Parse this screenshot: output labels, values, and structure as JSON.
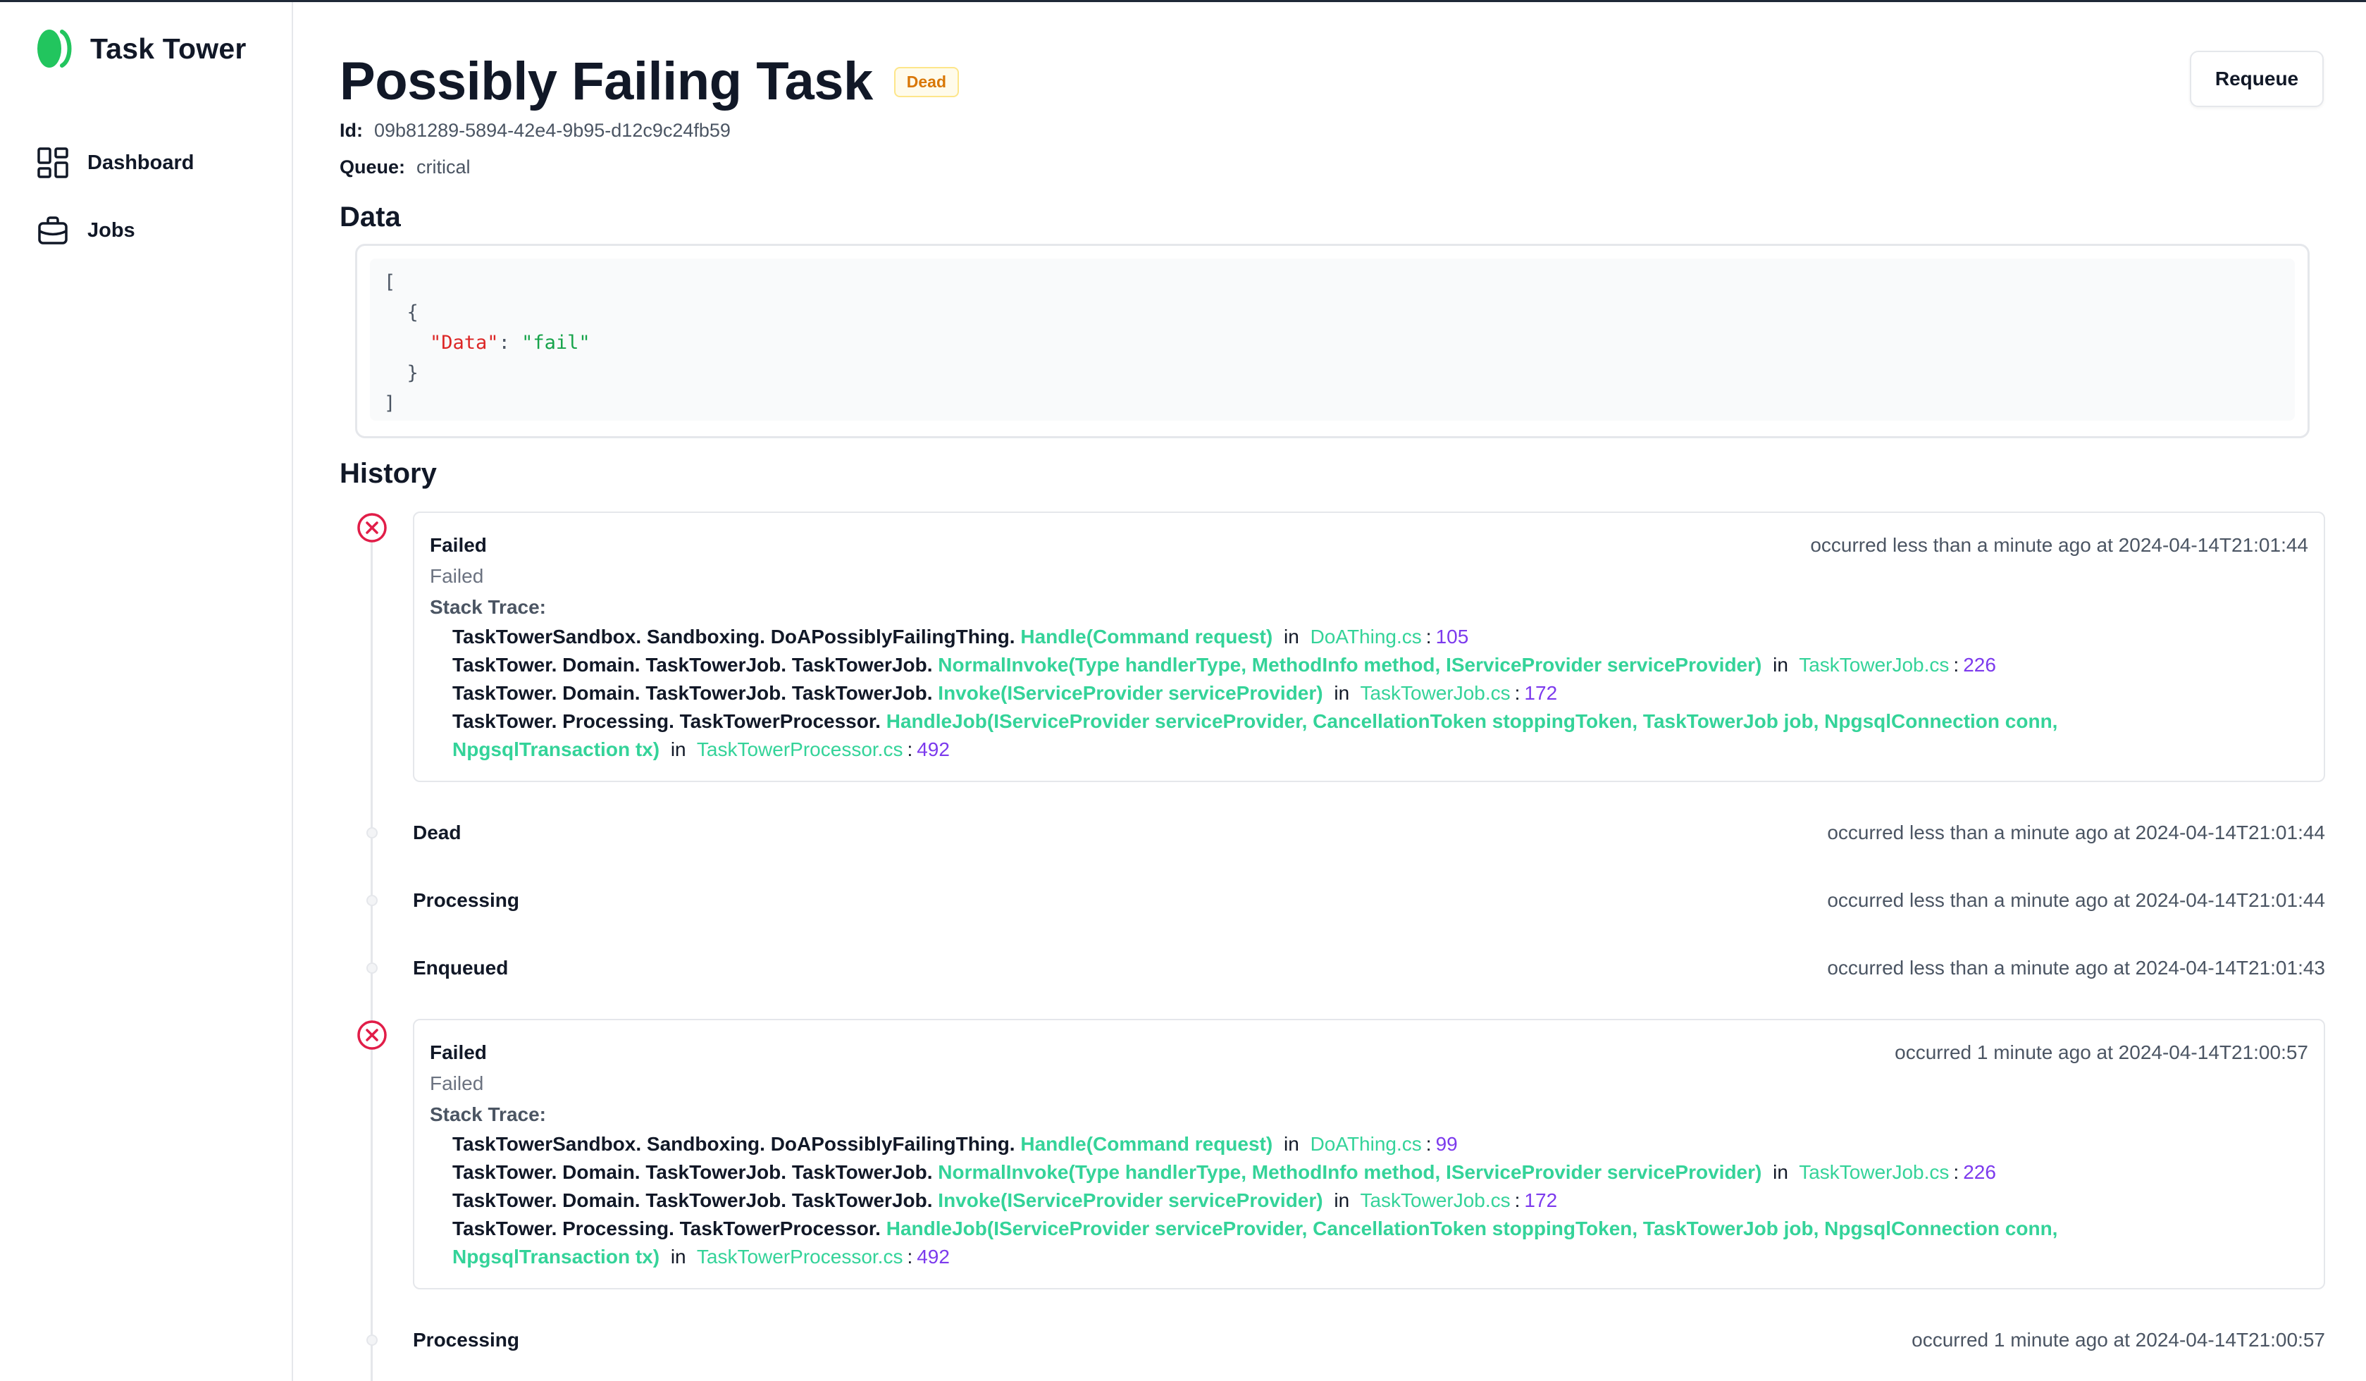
{
  "app": {
    "name": "Task Tower",
    "brand_color": "#22c55e"
  },
  "sidebar": {
    "items": [
      {
        "label": "Dashboard",
        "icon": "dashboard-grid-icon"
      },
      {
        "label": "Jobs",
        "icon": "briefcase-icon"
      }
    ]
  },
  "task": {
    "title": "Possibly Failing Task",
    "status_badge": "Dead",
    "id_label": "Id:",
    "id": "09b81289-5894-42e4-9b95-d12c9c24fb59",
    "queue_label": "Queue:",
    "queue": "critical",
    "requeue_label": "Requeue"
  },
  "data_section": {
    "heading": "Data",
    "json_key": "\"Data\"",
    "json_value": "\"fail\""
  },
  "history": {
    "heading": "History",
    "events": [
      {
        "type": "failed",
        "title": "Failed",
        "subtitle": "Failed",
        "stack_label": "Stack Trace:",
        "occurred": "occurred less than a minute ago at 2024-04-14T21:01:44",
        "trace": [
          {
            "ns": "TaskTowerSandbox. Sandboxing. DoAPossiblyFailingThing.",
            "fn": "Handle(Command request)",
            "in": "in",
            "file": "DoAThing.cs",
            "line": "105"
          },
          {
            "ns": "TaskTower. Domain. TaskTowerJob. TaskTowerJob.",
            "fn": "NormalInvoke(Type handlerType, MethodInfo method, IServiceProvider serviceProvider)",
            "in": "in",
            "file": "TaskTowerJob.cs",
            "line": "226"
          },
          {
            "ns": "TaskTower. Domain. TaskTowerJob. TaskTowerJob.",
            "fn": "Invoke(IServiceProvider serviceProvider)",
            "in": "in",
            "file": "TaskTowerJob.cs",
            "line": "172"
          },
          {
            "ns": "TaskTower. Processing. TaskTowerProcessor.",
            "fn": "HandleJob(IServiceProvider serviceProvider, CancellationToken stoppingToken, TaskTowerJob job, NpgsqlConnection conn,",
            "fn2": "NpgsqlTransaction tx)",
            "in": "in",
            "file": "TaskTowerProcessor.cs",
            "line": "492"
          }
        ]
      },
      {
        "type": "simple",
        "title": "Dead",
        "occurred": "occurred less than a minute ago at 2024-04-14T21:01:44"
      },
      {
        "type": "simple",
        "title": "Processing",
        "occurred": "occurred less than a minute ago at 2024-04-14T21:01:44"
      },
      {
        "type": "simple",
        "title": "Enqueued",
        "occurred": "occurred less than a minute ago at 2024-04-14T21:01:43"
      },
      {
        "type": "failed",
        "title": "Failed",
        "subtitle": "Failed",
        "stack_label": "Stack Trace:",
        "occurred": "occurred 1 minute ago at 2024-04-14T21:00:57",
        "trace": [
          {
            "ns": "TaskTowerSandbox. Sandboxing. DoAPossiblyFailingThing.",
            "fn": "Handle(Command request)",
            "in": "in",
            "file": "DoAThing.cs",
            "line": "99"
          },
          {
            "ns": "TaskTower. Domain. TaskTowerJob. TaskTowerJob.",
            "fn": "NormalInvoke(Type handlerType, MethodInfo method, IServiceProvider serviceProvider)",
            "in": "in",
            "file": "TaskTowerJob.cs",
            "line": "226"
          },
          {
            "ns": "TaskTower. Domain. TaskTowerJob. TaskTowerJob.",
            "fn": "Invoke(IServiceProvider serviceProvider)",
            "in": "in",
            "file": "TaskTowerJob.cs",
            "line": "172"
          },
          {
            "ns": "TaskTower. Processing. TaskTowerProcessor.",
            "fn": "HandleJob(IServiceProvider serviceProvider, CancellationToken stoppingToken, TaskTowerJob job, NpgsqlConnection conn,",
            "fn2": "NpgsqlTransaction tx)",
            "in": "in",
            "file": "TaskTowerProcessor.cs",
            "line": "492"
          }
        ]
      },
      {
        "type": "simple",
        "title": "Processing",
        "occurred": "occurred 1 minute ago at 2024-04-14T21:00:57"
      }
    ]
  },
  "colors": {
    "dead_badge": "#d97706",
    "failed_icon": "#e11d48",
    "trace_method": "#34d399",
    "trace_line": "#7c3aed"
  }
}
